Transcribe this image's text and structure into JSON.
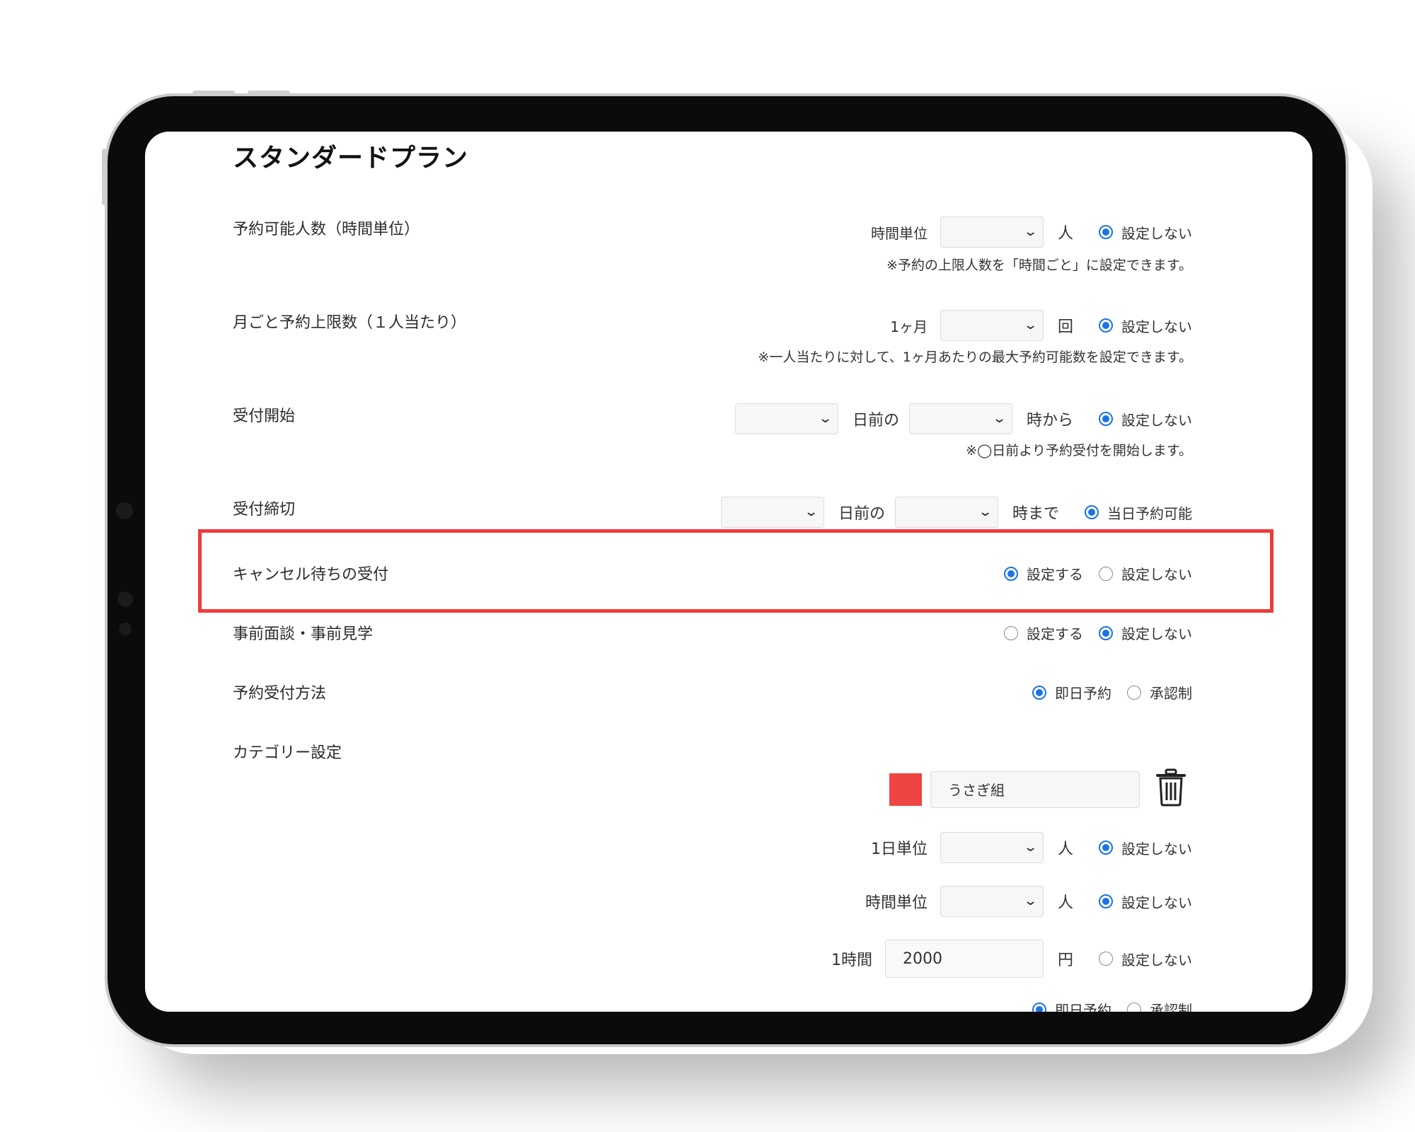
{
  "page": {
    "title": "スタンダードプラン"
  },
  "rows": {
    "capacity_hourly": {
      "label": "予約可能人数（時間単位）",
      "pre": "時間単位",
      "unit": "人",
      "radio": "設定しない",
      "note": "※予約の上限人数を「時間ごと」に設定できます。"
    },
    "monthly_limit": {
      "label": "月ごと予約上限数（１人当たり）",
      "pre": "1ヶ月",
      "unit": "回",
      "radio": "設定しない",
      "note": "※一人当たりに対して、1ヶ月あたりの最大予約可能数を設定できます。"
    },
    "reception_start": {
      "label": "受付開始",
      "mid": "日前の",
      "suffix": "時から",
      "radio": "設定しない",
      "note": "※◯日前より予約受付を開始します。"
    },
    "reception_end": {
      "label": "受付締切",
      "mid": "日前の",
      "suffix": "時まで",
      "radio": "当日予約可能"
    },
    "cancel_wait": {
      "label": "キャンセル待ちの受付",
      "opt_on": "設定する",
      "opt_off": "設定しない",
      "selected": "設定する"
    },
    "interview": {
      "label": "事前面談・事前見学",
      "opt_on": "設定する",
      "opt_off": "設定しない",
      "selected": "設定しない"
    },
    "method": {
      "label": "予約受付方法",
      "opt_a": "即日予約",
      "opt_b": "承認制",
      "selected": "即日予約"
    },
    "category": {
      "label": "カテゴリー設定",
      "color": "#ee4444",
      "name_value": "うさぎ組",
      "daily_pre": "1日単位",
      "daily_unit": "人",
      "daily_radio": "設定しない",
      "hourly_pre": "時間単位",
      "hourly_unit": "人",
      "hourly_radio": "設定しない",
      "price_pre": "1時間",
      "price_value": "2000",
      "price_unit": "円",
      "price_radio": "設定しない",
      "cut_opt_a": "即日予約",
      "cut_opt_b": "承認制"
    }
  },
  "colors": {
    "accent": "#1a73e8",
    "highlight": "#ef3b3b"
  }
}
